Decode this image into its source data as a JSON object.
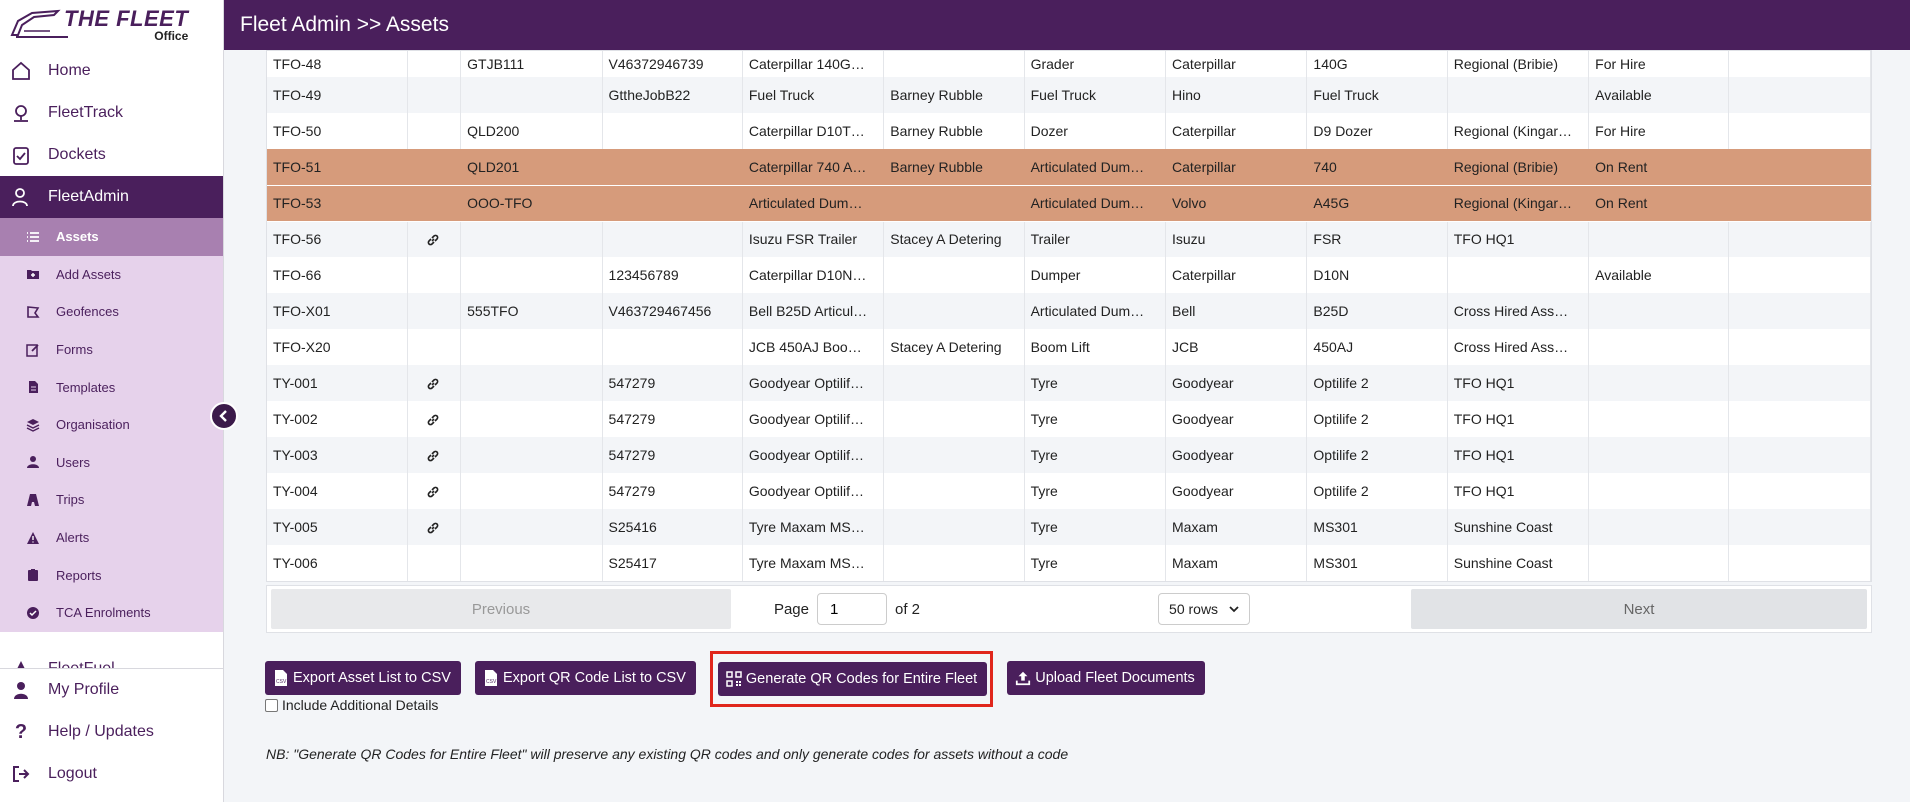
{
  "brand": {
    "title": "THE FLEET",
    "subtitle": "Office"
  },
  "header": {
    "title": "Fleet Admin >> Assets"
  },
  "nav": {
    "home": "Home",
    "fleettrack": "FleetTrack",
    "dockets": "Dockets",
    "fleetadmin": "FleetAdmin",
    "fleetfuel": "FleetFuel",
    "myprofile": "My Profile",
    "help": "Help / Updates",
    "logout": "Logout"
  },
  "subnav": {
    "assets": "Assets",
    "add_assets": "Add Assets",
    "geofences": "Geofences",
    "forms": "Forms",
    "templates": "Templates",
    "organisation": "Organisation",
    "users": "Users",
    "trips": "Trips",
    "alerts": "Alerts",
    "reports": "Reports",
    "tca": "TCA Enrolments"
  },
  "table": {
    "rows": [
      {
        "id": "TFO-48",
        "link": false,
        "rego": "GTJB111",
        "serial": "V46372946739",
        "desc": "Caterpillar 140G…",
        "operator": "",
        "type": "Grader",
        "make": "Caterpillar",
        "model": "140G",
        "location": "Regional (Bribie)",
        "status": "For Hire",
        "style": "even",
        "first": true
      },
      {
        "id": "TFO-49",
        "link": false,
        "rego": "",
        "serial": "GttheJobB22",
        "desc": "Fuel Truck",
        "operator": "Barney Rubble",
        "type": "Fuel Truck",
        "make": "Hino",
        "model": "Fuel Truck",
        "location": "",
        "status": "Available",
        "style": "odd"
      },
      {
        "id": "TFO-50",
        "link": false,
        "rego": "QLD200",
        "serial": "",
        "desc": "Caterpillar D10T…",
        "operator": "Barney Rubble",
        "type": "Dozer",
        "make": "Caterpillar",
        "model": "D9 Dozer",
        "location": "Regional (Kingar…",
        "status": "For Hire",
        "style": "even"
      },
      {
        "id": "TFO-51",
        "link": false,
        "rego": "QLD201",
        "serial": "",
        "desc": "Caterpillar 740 A…",
        "operator": "Barney Rubble",
        "type": "Articulated Dum…",
        "make": "Caterpillar",
        "model": "740",
        "location": "Regional (Bribie)",
        "status": "On Rent",
        "style": "highlight"
      },
      {
        "id": "TFO-53",
        "link": false,
        "rego": "OOO-TFO",
        "serial": "",
        "desc": "Articulated Dum…",
        "operator": "",
        "type": "Articulated Dum…",
        "make": "Volvo",
        "model": "A45G",
        "location": "Regional (Kingar…",
        "status": "On Rent",
        "style": "highlight"
      },
      {
        "id": "TFO-56",
        "link": true,
        "rego": "",
        "serial": "",
        "desc": "Isuzu FSR Trailer",
        "operator": "Stacey A Detering",
        "type": "Trailer",
        "make": "Isuzu",
        "model": "FSR",
        "location": "TFO HQ1",
        "status": "",
        "style": "odd"
      },
      {
        "id": "TFO-66",
        "link": false,
        "rego": "",
        "serial": "123456789",
        "desc": "Caterpillar D10N…",
        "operator": "",
        "type": "Dumper",
        "make": "Caterpillar",
        "model": "D10N",
        "location": "",
        "status": "Available",
        "style": "even"
      },
      {
        "id": "TFO-X01",
        "link": false,
        "rego": "555TFO",
        "serial": "V463729467456",
        "desc": "Bell B25D Articul…",
        "operator": "",
        "type": "Articulated Dum…",
        "make": "Bell",
        "model": "B25D",
        "location": "Cross Hired Ass…",
        "status": "",
        "style": "odd"
      },
      {
        "id": "TFO-X20",
        "link": false,
        "rego": "",
        "serial": "",
        "desc": "JCB 450AJ Boo…",
        "operator": "Stacey A Detering",
        "type": "Boom Lift",
        "make": "JCB",
        "model": "450AJ",
        "location": "Cross Hired Ass…",
        "status": "",
        "style": "even"
      },
      {
        "id": "TY-001",
        "link": true,
        "rego": "",
        "serial": "547279",
        "desc": "Goodyear Optilif…",
        "operator": "",
        "type": "Tyre",
        "make": "Goodyear",
        "model": "Optilife 2",
        "location": "TFO HQ1",
        "status": "",
        "style": "odd"
      },
      {
        "id": "TY-002",
        "link": true,
        "rego": "",
        "serial": "547279",
        "desc": "Goodyear Optilif…",
        "operator": "",
        "type": "Tyre",
        "make": "Goodyear",
        "model": "Optilife 2",
        "location": "TFO HQ1",
        "status": "",
        "style": "even"
      },
      {
        "id": "TY-003",
        "link": true,
        "rego": "",
        "serial": "547279",
        "desc": "Goodyear Optilif…",
        "operator": "",
        "type": "Tyre",
        "make": "Goodyear",
        "model": "Optilife 2",
        "location": "TFO HQ1",
        "status": "",
        "style": "odd"
      },
      {
        "id": "TY-004",
        "link": true,
        "rego": "",
        "serial": "547279",
        "desc": "Goodyear Optilif…",
        "operator": "",
        "type": "Tyre",
        "make": "Goodyear",
        "model": "Optilife 2",
        "location": "TFO HQ1",
        "status": "",
        "style": "even"
      },
      {
        "id": "TY-005",
        "link": true,
        "rego": "",
        "serial": "S25416",
        "desc": "Tyre Maxam MS…",
        "operator": "",
        "type": "Tyre",
        "make": "Maxam",
        "model": "MS301",
        "location": "Sunshine Coast",
        "status": "",
        "style": "odd"
      },
      {
        "id": "TY-006",
        "link": false,
        "rego": "",
        "serial": "S25417",
        "desc": "Tyre Maxam MS…",
        "operator": "",
        "type": "Tyre",
        "make": "Maxam",
        "model": "MS301",
        "location": "Sunshine Coast",
        "status": "",
        "style": "even"
      }
    ]
  },
  "pager": {
    "previous": "Previous",
    "page_label": "Page",
    "page_value": "1",
    "of_label": "of 2",
    "rows_value": "50 rows",
    "next": "Next"
  },
  "actions": {
    "export_csv": "Export Asset List to CSV",
    "export_qr": "Export QR Code List to CSV",
    "generate_qr": "Generate QR Codes for Entire Fleet",
    "upload_docs": "Upload Fleet Documents",
    "include_details": "Include Additional Details"
  },
  "note": "NB: \"Generate QR Codes for Entire Fleet\" will preserve any existing QR codes and only generate codes for assets without a code",
  "colors": {
    "brand": "#4a1f5c",
    "subnav_bg": "#e6d2eb",
    "highlight_row": "#d69b7b",
    "callout": "#e0261c"
  }
}
